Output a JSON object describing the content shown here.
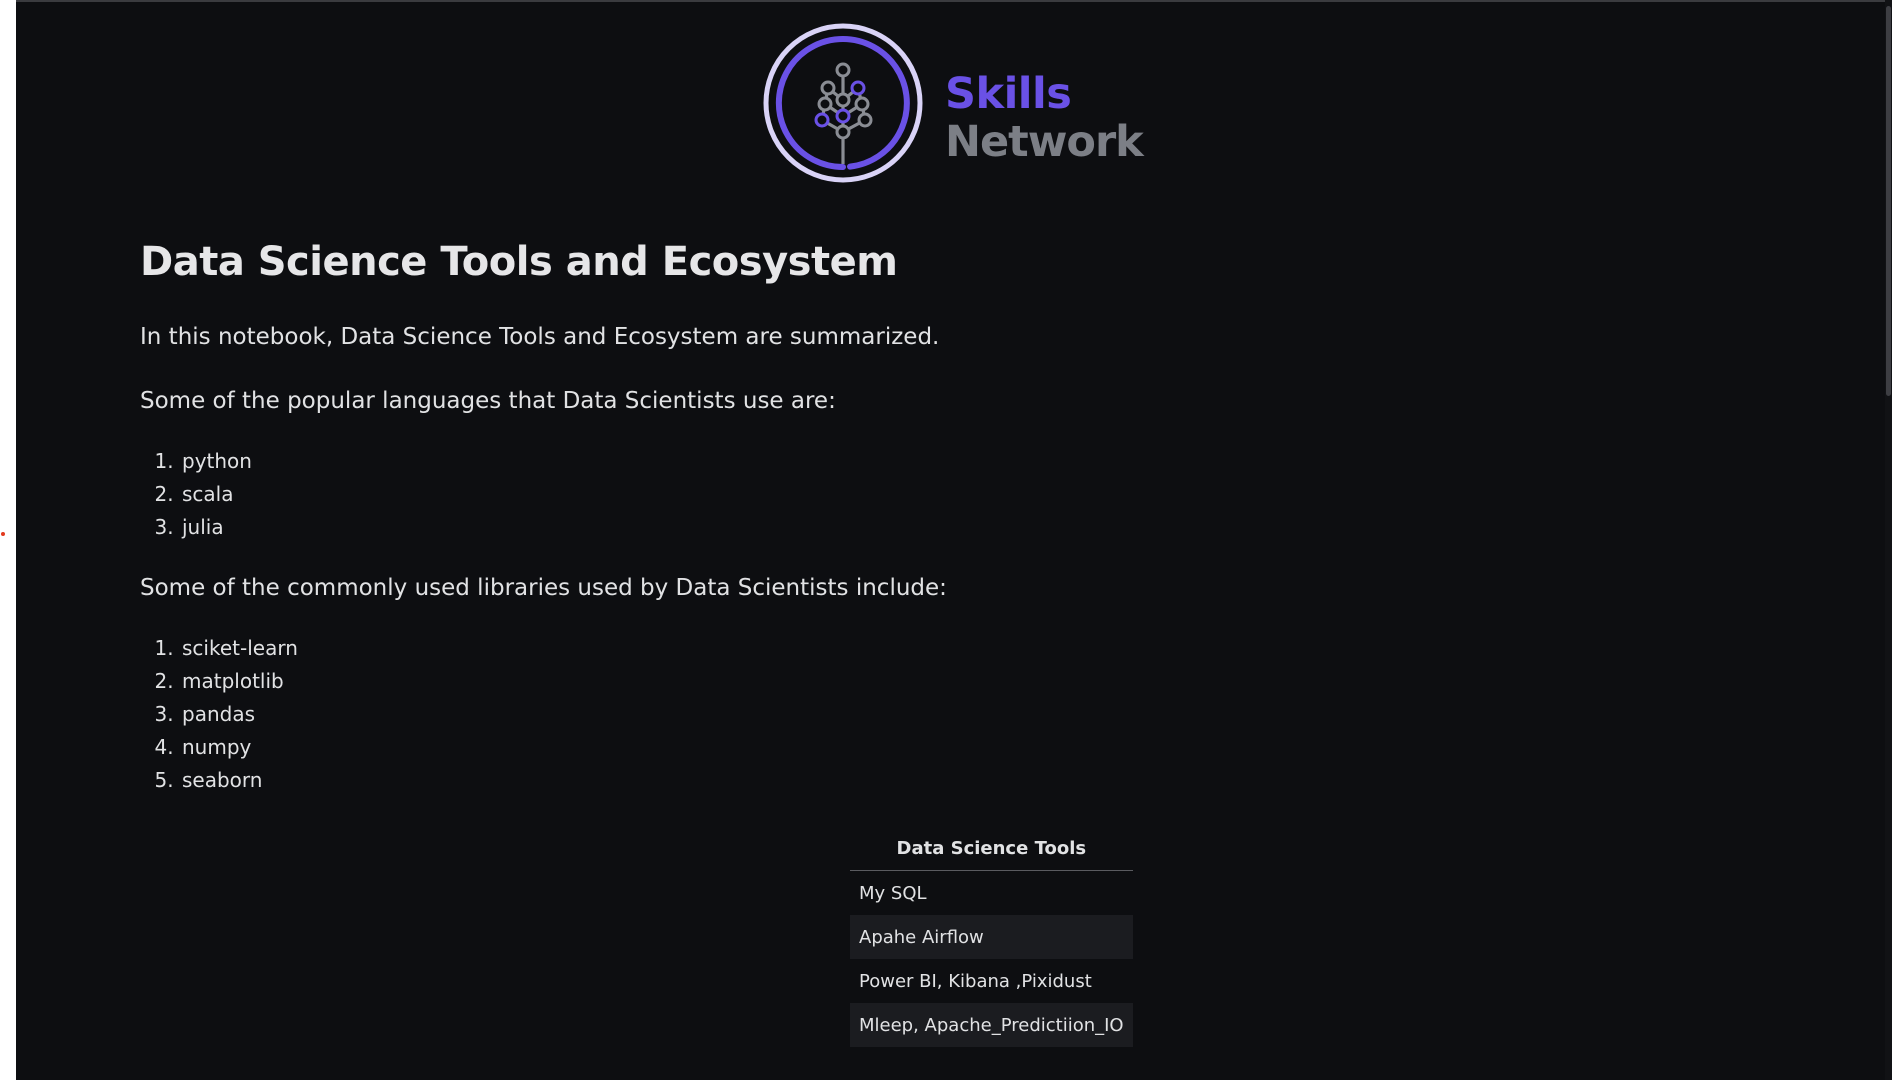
{
  "logo": {
    "brand_primary": "Skills",
    "brand_secondary": "Network",
    "icon": "tree-network-icon",
    "colors": {
      "primary": "#6a51e6",
      "secondary": "#7c7f86",
      "ring": "#d9d3f7"
    }
  },
  "notebook": {
    "title": "Data Science Tools and Ecosystem",
    "intro": "In this notebook, Data Science Tools and Ecosystem are summarized.",
    "languages_heading": "Some of the popular languages that Data Scientists use are:",
    "languages": [
      "python",
      "scala",
      "julia"
    ],
    "libraries_heading": "Some of the commonly used libraries used by Data Scientists include:",
    "libraries": [
      "sciket-learn",
      "matplotlib",
      "pandas",
      "numpy",
      "seaborn"
    ],
    "tools_table": {
      "header": "Data Science Tools",
      "rows": [
        "My SQL",
        "Apahe Airflow",
        "Power BI, Kibana ,Pixidust",
        "Mleep, Apache_Predictiion_IO"
      ]
    }
  },
  "theme": {
    "background": "#0d0e11",
    "text": "#e1e2e4",
    "table_stripe": "#1b1c20"
  }
}
